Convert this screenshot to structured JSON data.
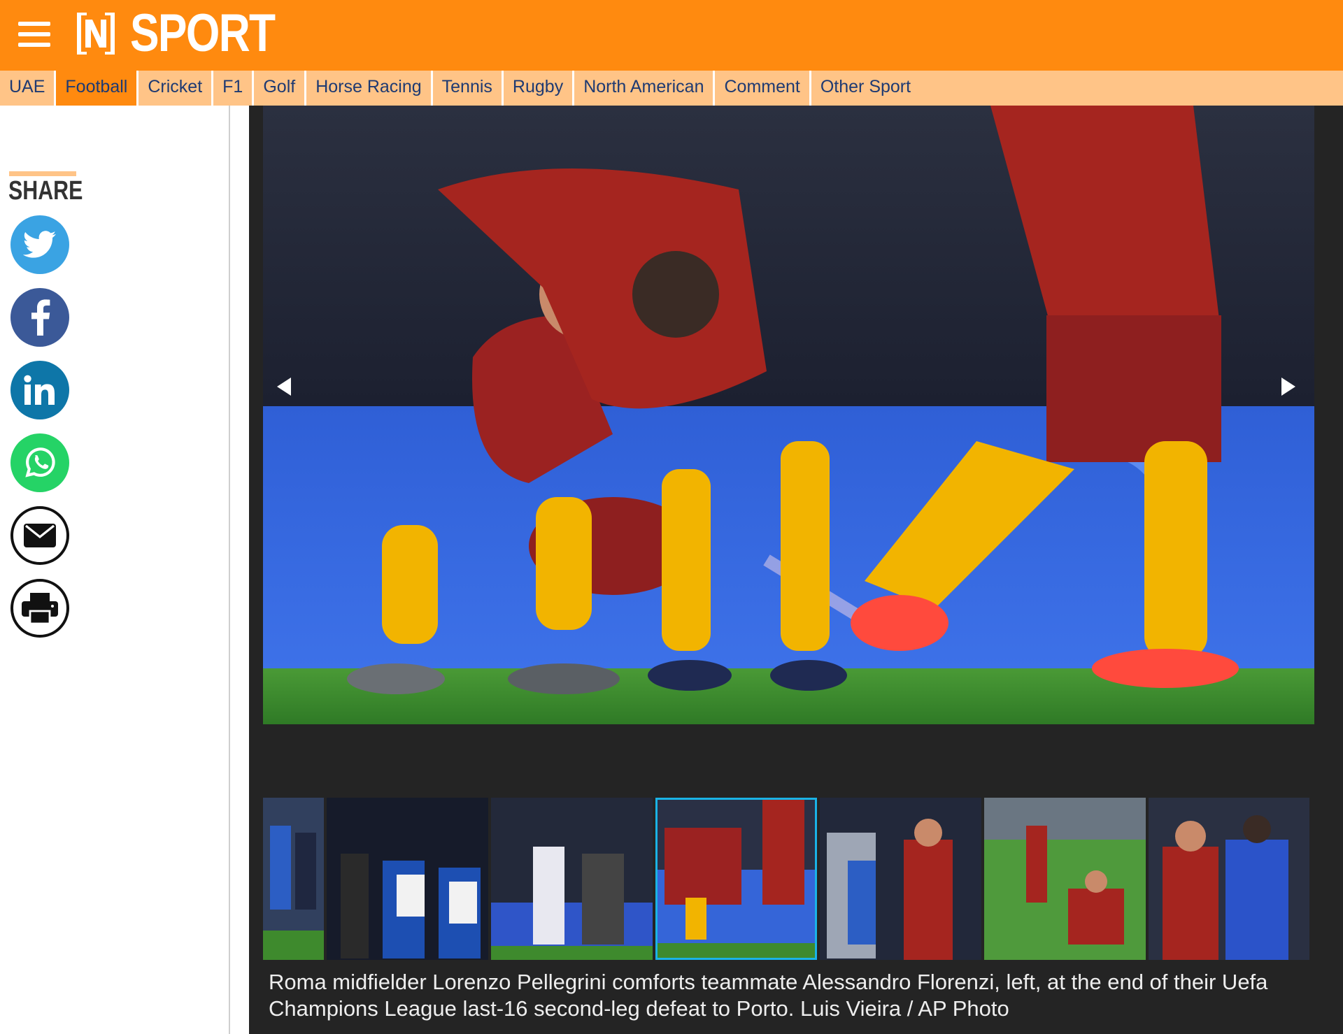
{
  "header": {
    "section_title": "SPORT",
    "brand_color": "#ff8a0f",
    "nav_color": "#ffc487"
  },
  "nav": {
    "items": [
      {
        "label": "UAE",
        "active": false
      },
      {
        "label": "Football",
        "active": true
      },
      {
        "label": "Cricket",
        "active": false
      },
      {
        "label": "F1",
        "active": false
      },
      {
        "label": "Golf",
        "active": false
      },
      {
        "label": "Horse Racing",
        "active": false
      },
      {
        "label": "Tennis",
        "active": false
      },
      {
        "label": "Rugby",
        "active": false
      },
      {
        "label": "North American",
        "active": false
      },
      {
        "label": "Comment",
        "active": false
      },
      {
        "label": "Other Sport",
        "active": false
      }
    ]
  },
  "share": {
    "title": "SHARE",
    "buttons": [
      {
        "icon": "twitter-icon",
        "color": "#3aa3e3"
      },
      {
        "icon": "facebook-icon",
        "color": "#3b5998"
      },
      {
        "icon": "linkedin-icon",
        "color": "#0e76a8"
      },
      {
        "icon": "whatsapp-icon",
        "color": "#25d366"
      },
      {
        "icon": "email-icon",
        "color": "#ffffff"
      },
      {
        "icon": "print-icon",
        "color": "#ffffff"
      }
    ]
  },
  "gallery": {
    "active_thumb_color": "#1ab3e6",
    "prev_icon": "chevron-left-icon",
    "next_icon": "chevron-right-icon",
    "thumbnails": [
      {
        "active": false
      },
      {
        "active": false
      },
      {
        "active": false
      },
      {
        "active": false
      },
      {
        "active": true
      },
      {
        "active": false
      },
      {
        "active": false
      },
      {
        "active": false
      }
    ],
    "caption": "Roma midfielder Lorenzo Pellegrini comforts teammate Alessandro Florenzi, left, at the end of their Uefa Champions League last-16 second-leg defeat to Porto. Luis Vieira / AP Photo"
  }
}
